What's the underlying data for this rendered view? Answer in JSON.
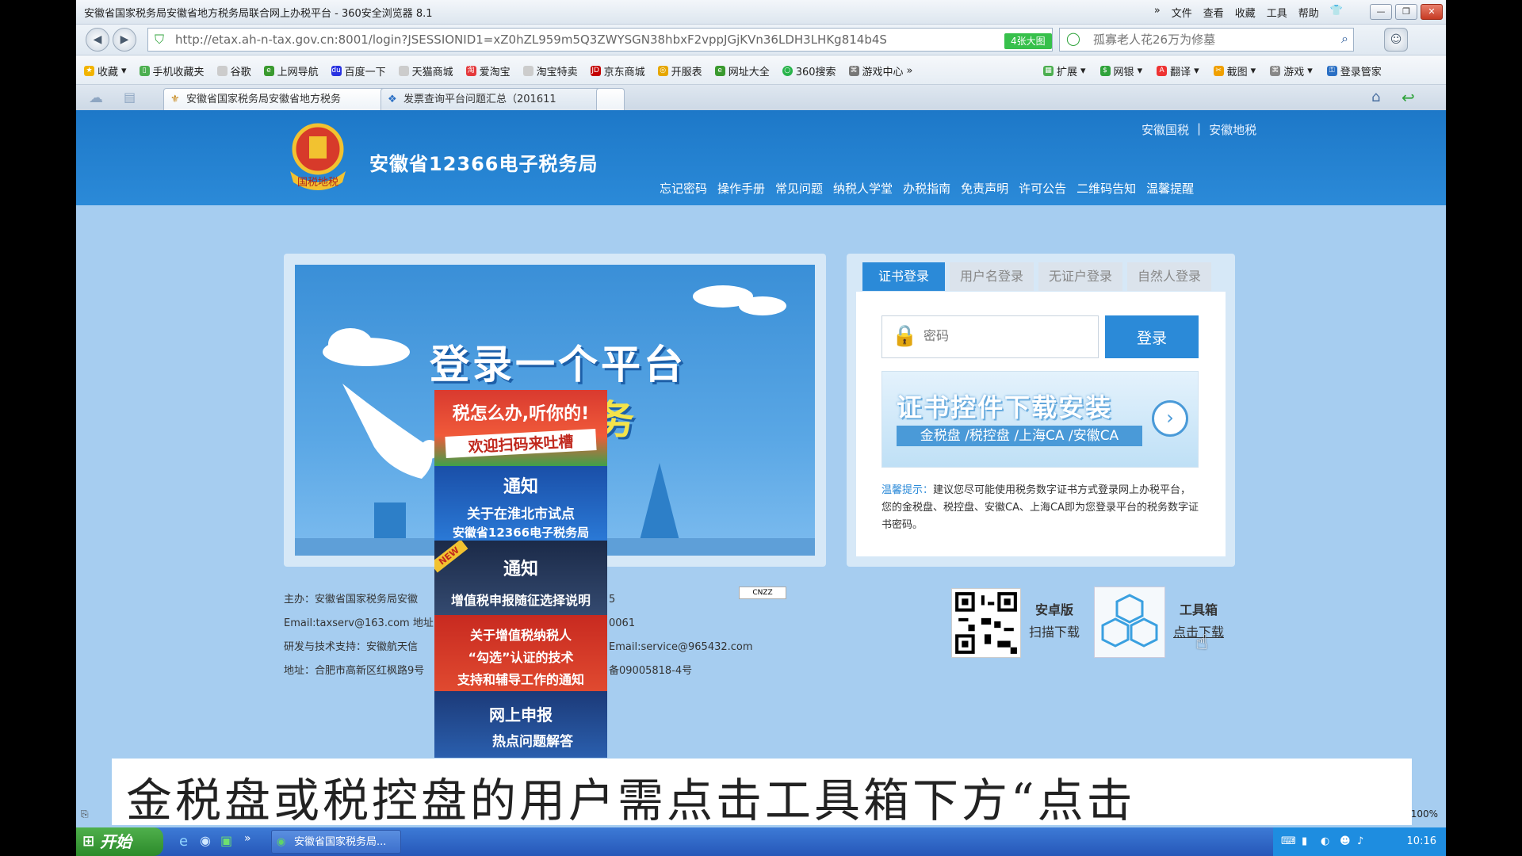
{
  "window": {
    "title": "安徽省国家税务局安徽省地方税务局联合网上办税平台 - 360安全浏览器 8.1",
    "menu": [
      "文件",
      "查看",
      "收藏",
      "工具",
      "帮助"
    ]
  },
  "address": {
    "url": "http://etax.ah-n-tax.gov.cn:8001/login?JSESSIONID1=xZ0hZL959m5Q3ZWYSGN38hbxF2vppJGjKVn36LDH3LHKg814b4S",
    "badge": "4张大图",
    "search_placeholder": "孤寡老人花26万为修墓"
  },
  "bookmarks": {
    "left": [
      "收藏",
      "手机收藏夹",
      "谷歌",
      "上网导航",
      "百度一下",
      "天猫商城",
      "爱淘宝",
      "淘宝特卖",
      "京东商城",
      "开服表",
      "网址大全",
      "360搜索",
      "游戏中心"
    ],
    "right": [
      "扩展",
      "网银",
      "翻译",
      "截图",
      "游戏",
      "登录管家"
    ]
  },
  "tabs": [
    {
      "label": "安徽省国家税务局安徽省地方税务"
    },
    {
      "label": "发票查询平台问题汇总（201611"
    }
  ],
  "site": {
    "emblem_text": "国税地税",
    "title": "安徽省12366电子税务局",
    "top_links": [
      "安徽国税",
      "|",
      "安徽地税"
    ],
    "nav": [
      "忘记密码",
      "操作手册",
      "常见问题",
      "纳税人学堂",
      "办税指南",
      "免责声明",
      "许可公告",
      "二维码告知",
      "温馨提醒"
    ]
  },
  "banner": {
    "line1": "登录一个平台",
    "line2": "两家业务"
  },
  "float_notices": [
    {
      "title": "税怎么办,听你的!",
      "sub": "欢迎扫码来吐槽"
    },
    {
      "title": "通知",
      "sub": "关于在淮北市试点",
      "sub2": "安徽省12366电子税务局"
    },
    {
      "title": "通知",
      "sub": "增值税申报随征选择说明",
      "tag": "NEW"
    },
    {
      "title": "关于增值税纳税人",
      "sub": "“勾选”认证的技术",
      "sub2": "支持和辅导工作的通知"
    },
    {
      "title": "网上申报",
      "sub": "热点问题解答"
    }
  ],
  "login": {
    "tabs": [
      "证书登录",
      "用户名登录",
      "无证户登录",
      "自然人登录"
    ],
    "password_placeholder": "密码",
    "login_button": "登录",
    "cert_title": "证书控件下载安装",
    "cert_sub": "金税盘 /税控盘 /上海CA /安徽CA",
    "tip_label": "温馨提示：",
    "tip_text": "建议您尽可能使用税务数字证书方式登录网上办税平台，您的金税盘、税控盘、安徽CA、上海CA即为您登录平台的税务数字证书密码。"
  },
  "footer": [
    "主办：安徽省国家税务局安徽",
    "Email:taxserv@163.com 地址：",
    "研发与技术支持：安徽航天信",
    "地址：合肥市高新区红枫路9号"
  ],
  "footer_right": [
    "5",
    "0061",
    "Email:service@965432.com",
    "备09005818-4号"
  ],
  "cnzz": "CNZZ",
  "downloads": {
    "android_title": "安卓版",
    "android_sub": "扫描下载",
    "toolbox_title": "工具箱",
    "toolbox_sub": "点击下载"
  },
  "subtitle": "金税盘或税控盘的用户需点击工具箱下方“点击",
  "status": {
    "zoom": "100%"
  },
  "taskbar": {
    "start": "开始",
    "task": "安徽省国家税务局...",
    "clock": "10:16"
  }
}
